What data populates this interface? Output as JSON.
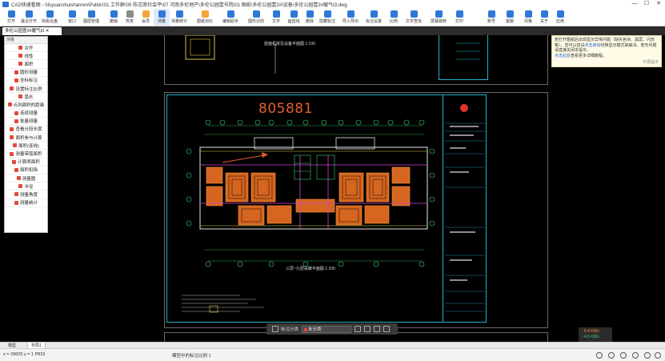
{
  "window": {
    "title": "CAD快速看图 - \\\\fuyuanshuishanren\\Public\\01 工作群\\05 陈志荣社会平\\07 河南多伦地产\\多伦公园壹号院\\01 图纸\\多伦公园壹2#\\设备\\多伦公园壹2#暖气t3.dwg",
    "minimize": "—",
    "maximize": "☐",
    "close": "✕"
  },
  "toolbar": {
    "items": [
      {
        "label": "打开",
        "icon": "folder-icon"
      },
      {
        "label": "最近打开",
        "icon": "recent-icon"
      },
      {
        "label": "快看云盘",
        "icon": "cloud-icon"
      },
      {
        "label": "窗口",
        "icon": "window-icon"
      },
      {
        "label": "图层管理",
        "icon": "layers-icon"
      },
      {
        "label": "撤销",
        "icon": "undo-icon"
      },
      {
        "label": "恢复",
        "icon": "redo-icon"
      },
      {
        "label": "会员",
        "icon": "vip-icon"
      },
      {
        "label": "测量",
        "icon": "measure-icon"
      },
      {
        "label": "测量统计",
        "icon": "measure-stats-icon"
      },
      {
        "label": "图纸对比",
        "icon": "compare-icon"
      },
      {
        "label": "编辑助手",
        "icon": "edit-assistant-icon"
      },
      {
        "label": "图形识别",
        "icon": "recognize-icon"
      },
      {
        "label": "文字",
        "icon": "text-icon"
      },
      {
        "label": "画直线",
        "icon": "line-icon"
      },
      {
        "label": "删除",
        "icon": "delete-icon"
      },
      {
        "label": "隐藏标注",
        "icon": "hide-annotation-icon"
      },
      {
        "label": "导入导出",
        "icon": "import-export-icon"
      },
      {
        "label": "标注设置",
        "icon": "annotation-settings-icon"
      },
      {
        "label": "比例",
        "icon": "scale-icon"
      },
      {
        "label": "文字查找",
        "icon": "text-search-icon"
      },
      {
        "label": "屏幕旋转",
        "icon": "rotate-icon"
      },
      {
        "label": "打印",
        "icon": "print-icon"
      },
      {
        "label": "账号",
        "icon": "account-icon"
      },
      {
        "label": "客服",
        "icon": "support-icon"
      },
      {
        "label": "风格",
        "icon": "style-icon"
      },
      {
        "label": "关于",
        "icon": "about-icon"
      },
      {
        "label": "应用",
        "icon": "apps-icon"
      }
    ]
  },
  "doc_tab": {
    "label": "多伦公园壹2#暖气t3 ✕"
  },
  "left_panel": {
    "header": "测量",
    "items": [
      "对齐",
      "线性",
      "面积",
      "圆形测量",
      "坐标标注",
      "设置标注比例",
      "弧长",
      "点到面积的距离",
      "连续测量",
      "批量测量",
      "查看分段长度",
      "面积参与计算",
      "面积(连线)",
      "测量带弧面积",
      "计算两面积",
      "面积扣除",
      "测量圆",
      "半径",
      "测量角度",
      "测量统计"
    ]
  },
  "notification": {
    "text1": "若打开图纸后出现显示异常问题（缺失色块、黑屏、闪烁等），您可以尝试",
    "link": "点击启动",
    "text2": "切换显示模式来解决。若无问题请直接关闭本提示。",
    "tutorial_link": "点击此处",
    "text3": "查看更多详细教程。",
    "dismiss": "不再提示"
  },
  "drawing": {
    "code": "805881",
    "top_title": "屋面机房及设备平面图 1:100",
    "plan_title": "三层~九层采暖平面图 1:100"
  },
  "bottom_bar": {
    "label": "标注分类",
    "selected": "未分类"
  },
  "network_speed": {
    "up": "↑ 6.4 KB/s",
    "down": "↓ 4.6 KB/s"
  },
  "model_tabs": [
    "模型",
    "布局1"
  ],
  "statusbar": {
    "coords": "x = 39829  y = 1 P833",
    "scale": "模型中的标注比例 1"
  }
}
